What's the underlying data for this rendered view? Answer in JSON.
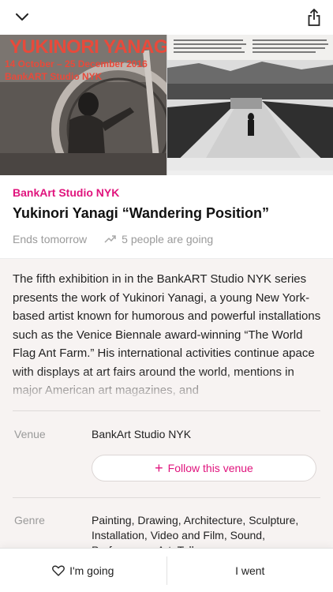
{
  "topbar": {
    "back_icon": "chevron-down-icon",
    "share_icon": "share-icon"
  },
  "poster": {
    "title": "YUKINORI YANAGI",
    "dates": "14 October – 25 December 2016",
    "venue": "BankART Studio NYK"
  },
  "event": {
    "venue_name": "BankArt Studio NYK",
    "title": "Yukinori Yanagi “Wandering Position”",
    "status": "Ends tomorrow",
    "going": "5 people are going"
  },
  "description": "The fifth exhibition in in the BankART Studio NYK series presents the work of Yukinori Yanagi, a young New York-based artist known for humorous and powerful installations such as the Venice Biennale award-winning “The World Flag Ant Farm.” His international activities continue apace with displays at art fairs around the world, mentions in major American art magazines, and",
  "details": {
    "venue_label": "Venue",
    "venue_value": "BankArt Studio NYK",
    "follow_label": "Follow this venue",
    "genre_label": "Genre",
    "genre_value": "Painting, Drawing, Architecture, Sculpture, Installation, Video and Film, Sound, Performance Art, Talk"
  },
  "actions": {
    "going_label": "I'm going",
    "went_label": "I went"
  },
  "colors": {
    "accent": "#e0147d",
    "poster_text": "#e84a3b"
  }
}
